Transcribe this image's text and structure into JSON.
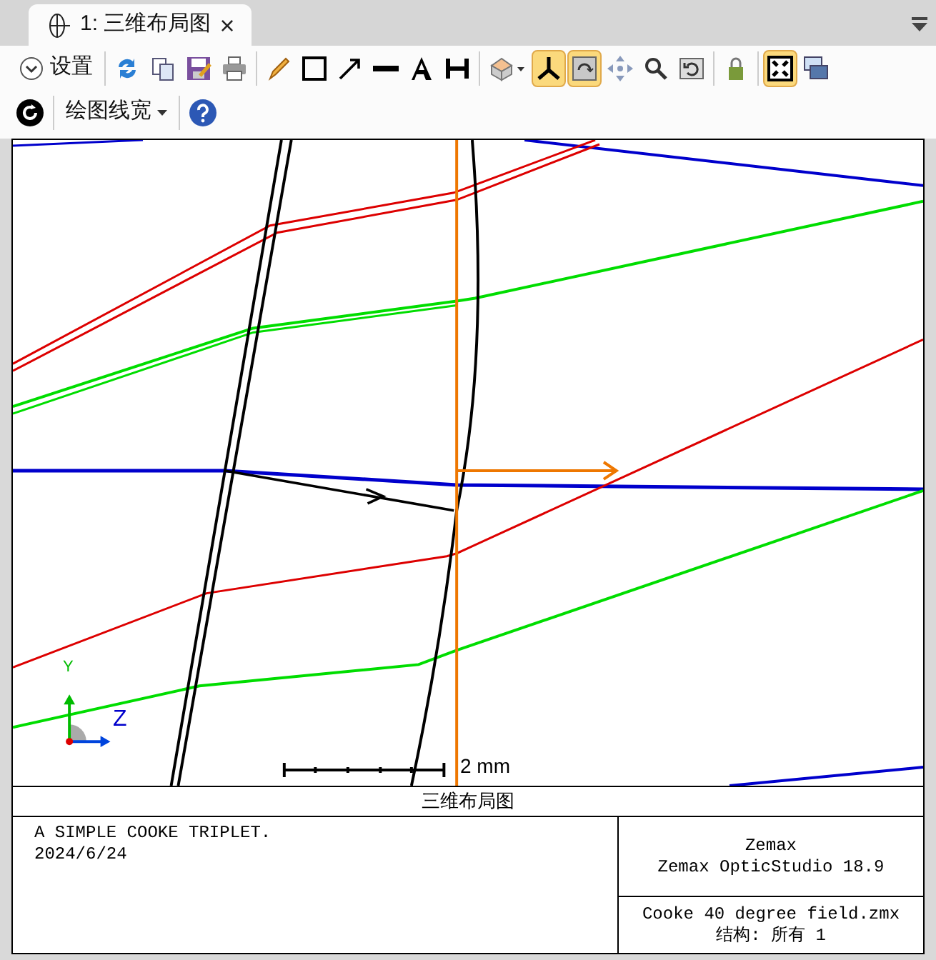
{
  "tab": {
    "title": "1: 三维布局图",
    "close": "×",
    "selected": true
  },
  "toolbar": {
    "row_1": [
      {
        "kind": "settings",
        "label": "设置",
        "on": false
      },
      {
        "kind": "refresh",
        "on": false
      },
      {
        "kind": "copy",
        "on": false
      },
      {
        "kind": "save",
        "on": false
      },
      {
        "kind": "print",
        "on": false
      },
      {
        "kind": "pencil",
        "on": false
      },
      {
        "kind": "rectangle",
        "on": false
      },
      {
        "kind": "arrow",
        "on": false
      },
      {
        "kind": "line",
        "on": false
      },
      {
        "kind": "text",
        "on": false
      },
      {
        "kind": "dimension",
        "on": false
      },
      {
        "kind": "view",
        "on": false
      },
      {
        "kind": "axes",
        "on": true
      },
      {
        "kind": "rotate",
        "on": true
      },
      {
        "kind": "move",
        "on": false
      },
      {
        "kind": "zoom",
        "on": false
      },
      {
        "kind": "reset",
        "on": false
      },
      {
        "kind": "lock",
        "on": false
      },
      {
        "kind": "fit",
        "on": true
      },
      {
        "kind": "windows",
        "on": false
      }
    ],
    "row_2": [
      {
        "kind": "power",
        "on": false
      },
      {
        "kind": "dropdown",
        "label": "绘图线宽",
        "on": false
      },
      {
        "kind": "help",
        "on": false
      }
    ]
  },
  "plot": {
    "scale_label": "2 mm",
    "axis_y": "Y",
    "axis_z": "Z"
  },
  "title_block": {
    "caption": "三维布局图",
    "lens_title": "A SIMPLE COOKE TRIPLET.",
    "date": "2024/6/24",
    "company": "Zemax",
    "program": "Zemax OpticStudio 18.9",
    "file": "Cooke 40 degree field.zmx",
    "configuration": "结构: 所有 1"
  }
}
